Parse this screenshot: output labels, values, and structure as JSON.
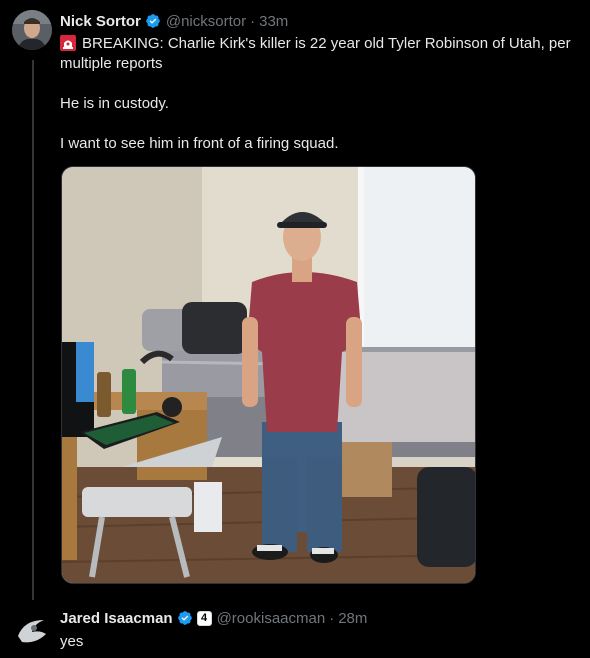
{
  "tweet": {
    "author_name": "Nick Sortor",
    "handle": "@nicksortor",
    "separator": "·",
    "time": "33m",
    "text_line1": "BREAKING: Charlie Kirk's killer is 22 year old Tyler Robinson of Utah, per multiple reports",
    "text_line2": "He is in custody.",
    "text_line3": "I want to see him in front of a firing squad.",
    "emoji": "rotating-light-icon"
  },
  "reply": {
    "author_name": "Jared Isaacman",
    "affiliate_badge": "4",
    "handle": "@rookisaacman",
    "separator": "·",
    "time": "28m",
    "text": "yes"
  },
  "colors": {
    "background": "#000000",
    "text": "#e7e9ea",
    "muted": "#71767b",
    "verified": "#1d9bf0",
    "thread_line": "#333639"
  }
}
